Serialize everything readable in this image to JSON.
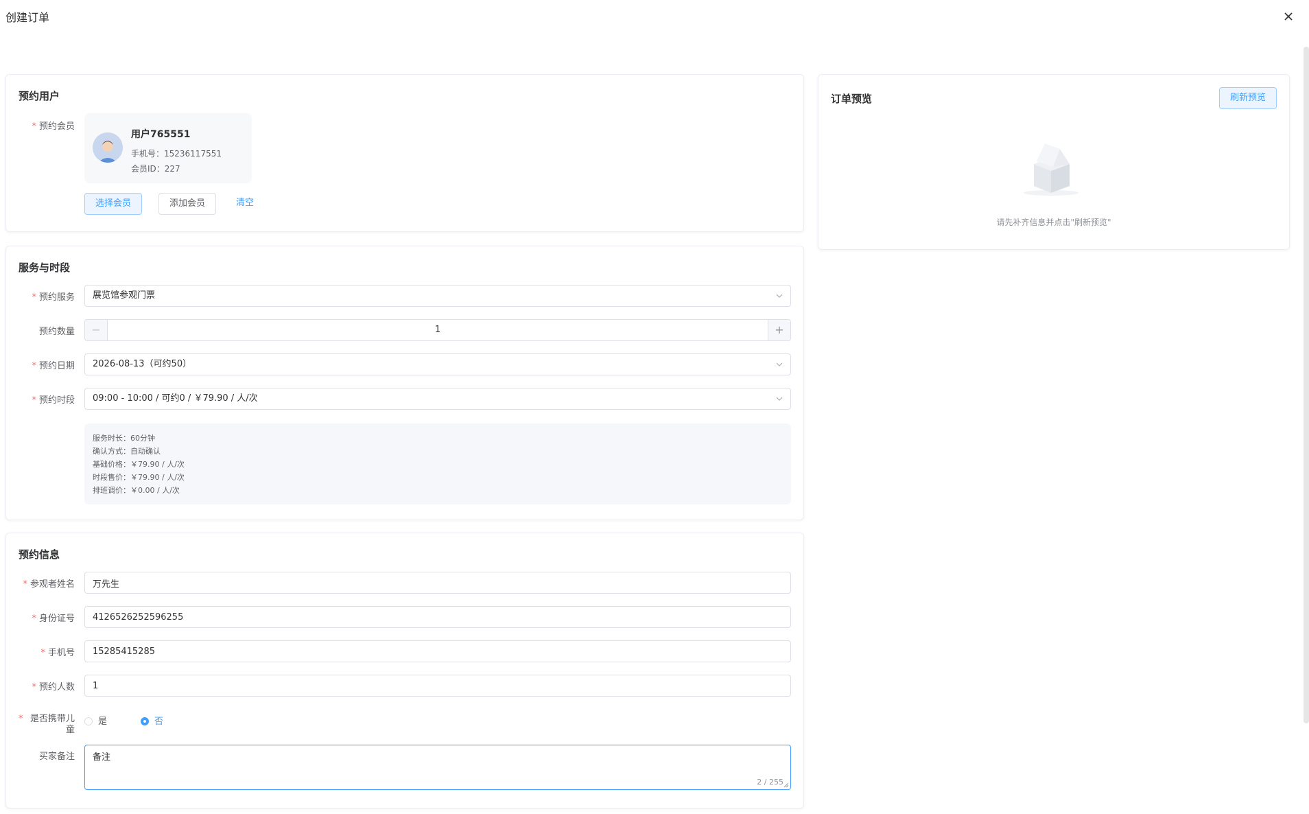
{
  "dialog": {
    "title": "创建订单"
  },
  "member_card": {
    "title": "预约用户",
    "label": "预约会员",
    "name": "用户765551",
    "phone": "手机号：15236117551",
    "member_id": "会员ID：227",
    "select_button": "选择会员",
    "add_button": "添加会员",
    "clear_link": "清空"
  },
  "service_card": {
    "title": "服务与时段",
    "service_label": "预约服务",
    "service_value": "展览馆参观门票",
    "quantity_label": "预约数量",
    "quantity_value": "1",
    "date_label": "预约日期",
    "date_value": "2026-08-13（可约50）",
    "slot_label": "预约时段",
    "slot_value": "09:00 - 10:00 / 可约0 / ￥79.90 / 人/次",
    "info": [
      "服务时长：60分钟",
      "确认方式：自动确认",
      "基础价格：￥79.90 / 人/次",
      "时段售价：￥79.90 / 人/次",
      "排班调价：￥0.00 / 人/次"
    ]
  },
  "booking_card": {
    "title": "预约信息",
    "name_label": "参观者姓名",
    "name_value": "万先生",
    "id_label": "身份证号",
    "id_value": "4126526252596255",
    "phone_label": "手机号",
    "phone_value": "15285415285",
    "count_label": "预约人数",
    "count_value": "1",
    "child_label_line1": "是否携带儿",
    "child_label_line2": "童",
    "radio_yes": "是",
    "radio_no": "否",
    "child_selected": "否",
    "note_label": "买家备注",
    "note_value": "备注",
    "note_count": "2 / 255"
  },
  "preview_card": {
    "title": "订单预览",
    "refresh_button": "刷新预览",
    "empty_text": "请先补齐信息并点击\"刷新预览\""
  },
  "colors": {
    "primary": "#409eff",
    "required": "#f56c6c",
    "border": "#dcdfe6"
  },
  "icons": {
    "close": "close-icon",
    "chevron": "chevron-down-icon",
    "empty": "empty-box-icon",
    "avatar": "user-avatar"
  }
}
